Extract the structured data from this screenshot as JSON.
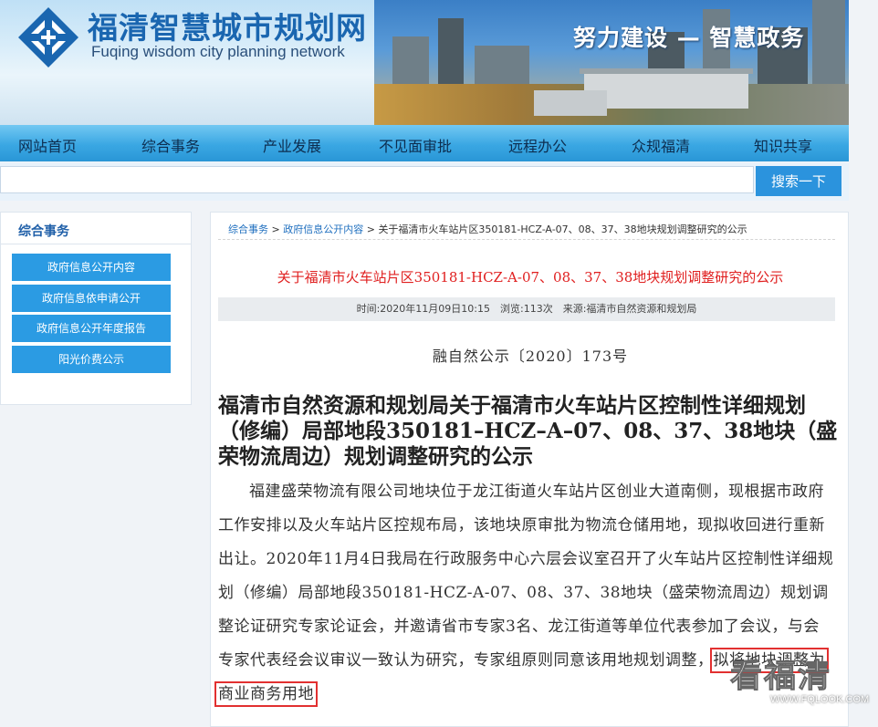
{
  "header": {
    "site_title": "福清智慧城市规划网",
    "site_subtitle": "Fuqing wisdom city planning network",
    "slogan": "努力建设 — 智慧政务"
  },
  "nav": {
    "items": [
      "网站首页",
      "综合事务",
      "产业发展",
      "不见面审批",
      "远程办公",
      "众规福清",
      "知识共享"
    ]
  },
  "search": {
    "placeholder": "",
    "button_label": "搜索一下"
  },
  "sidebar": {
    "title": "综合事务",
    "items": [
      "政府信息公开内容",
      "政府信息依申请公开",
      "政府信息公开年度报告",
      "阳光价费公示"
    ]
  },
  "breadcrumb": {
    "items": [
      "综合事务",
      "政府信息公开内容"
    ],
    "separator": ">",
    "current": "关于福清市火车站片区350181-HCZ-A-07、08、37、38地块规划调整研究的公示"
  },
  "article": {
    "title": "关于福清市火车站片区350181-HCZ-A-07、08、37、38地块规划调整研究的公示",
    "meta": "时间:2020年11月09日10:15　浏览:113次　来源:福清市自然资源和规划局",
    "doc_number": "融自然公示〔2020〕173号",
    "heading": "福清市自然资源和规划局关于福清市火车站片区控制性详细规划（修编）局部地段350181–HCZ–A–07、08、37、38地块（盛荣物流周边）规划调整研究的公示",
    "body_main": "福建盛荣物流有限公司地块位于龙江街道火车站片区创业大道南侧，现根据市政府工作安排以及火车站片区控规布局，该地块原审批为物流仓储用地，现拟收回进行重新出让。2020年11月4日我局在行政服务中心六层会议室召开了火车站片区控制性详细规划（修编）局部地段350181-HCZ-A-07、08、37、38地块（盛荣物流周边）规划调整论证研究专家论证会，并邀请省市专家3名、龙江街道等单位代表参加了会议，与会专家代表经会议审议一致认为研究，专家组原则同意该用地规划调整，",
    "body_highlight": "拟将地块调整为商业商务用地"
  },
  "watermark": {
    "text": "看福清",
    "url": "WWW.FQLOOK.COM"
  },
  "colors": {
    "accent": "#2b9be3",
    "title_red": "#e02020",
    "link_blue": "#1f6fbf"
  }
}
